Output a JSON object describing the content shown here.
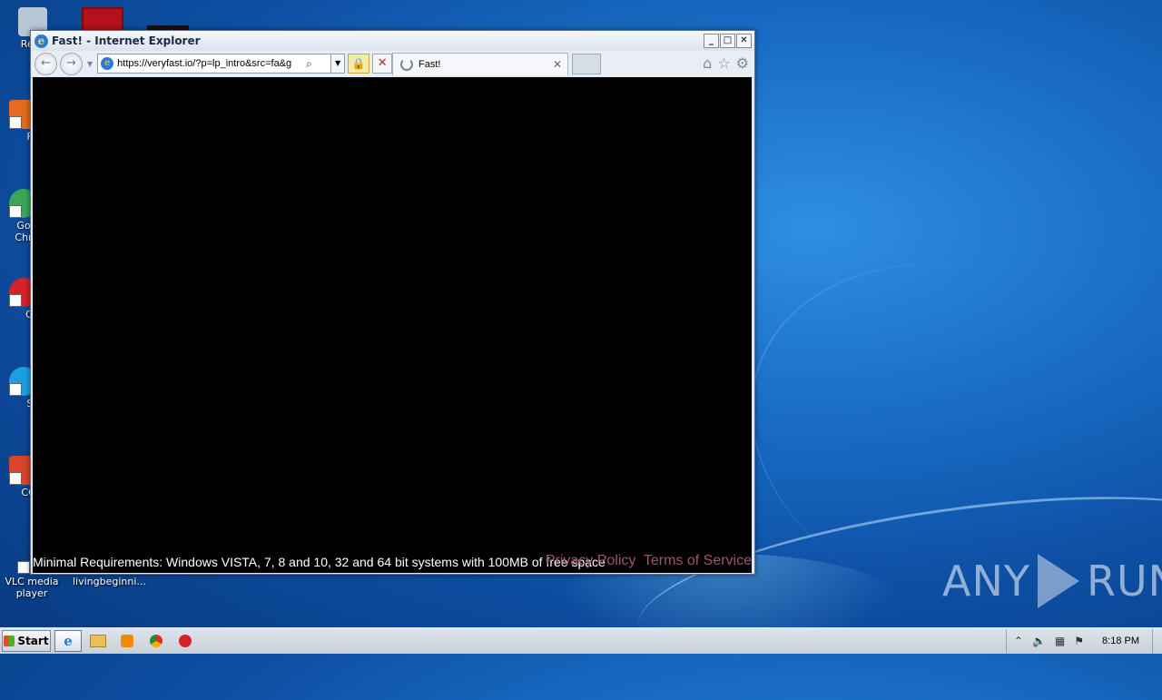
{
  "window": {
    "title": "Fast! - Internet Explorer",
    "minimize": "_",
    "maximize": "□",
    "close": "✕"
  },
  "toolbar": {
    "url": "https://veryfast.io/?p=lp_intro&src=fa&g",
    "tab_title": "Fast!",
    "tab_close": "✕"
  },
  "page": {
    "requirements": "Minimal Requirements: Windows VISTA, 7, 8 and 10, 32 and 64 bit systems with 100MB of free space",
    "privacy": "Privacy Policy",
    "terms": "Terms of Service"
  },
  "desktop": {
    "icons": [
      {
        "label": "Recy",
        "color": "#b8c7d6"
      },
      {
        "label": "Fir",
        "color": "#e66a1f"
      },
      {
        "label": "Go Chr",
        "color": "#3aa757"
      },
      {
        "label": "Op",
        "color": "#d2232a"
      },
      {
        "label": "Sk",
        "color": "#1aa0e0"
      },
      {
        "label": "CCle",
        "color": "#d9452a"
      },
      {
        "label": "VLC media player",
        "color": "#f08a00"
      },
      {
        "label": "livingbeginni...",
        "color": "#e8edf3"
      }
    ]
  },
  "watermark": {
    "left": "ANY",
    "right": "RUN"
  },
  "taskbar": {
    "start": "Start",
    "clock": "8:18 PM"
  }
}
